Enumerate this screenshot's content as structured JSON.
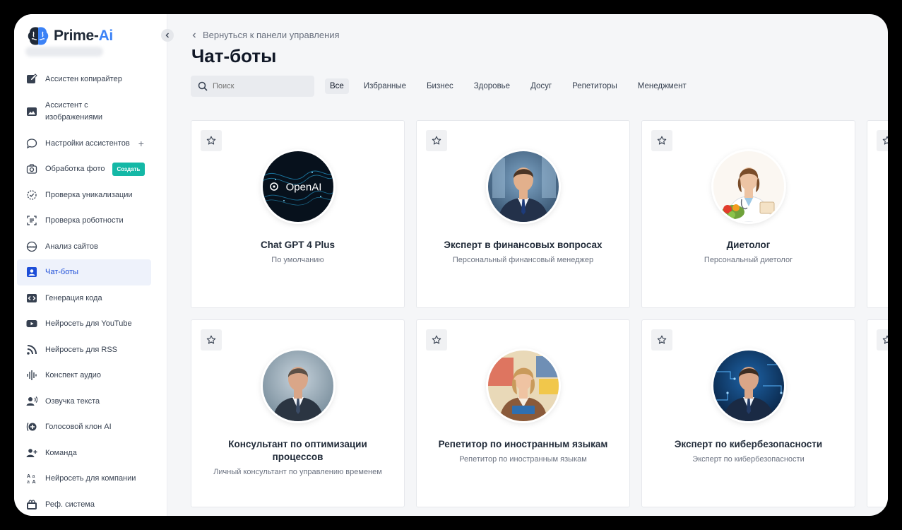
{
  "brand": {
    "name_prefix": "Prime-",
    "name_suffix": "Ai",
    "accent": "#3b82f6"
  },
  "sidebar": {
    "items": [
      {
        "label": "Ассистен копирайтер",
        "icon": "edit-icon"
      },
      {
        "label": "Ассистент с изображениями",
        "icon": "image-icon"
      },
      {
        "label": "Настройки ассистентов",
        "icon": "chat-bubble-icon",
        "extra": "+"
      },
      {
        "label": "Обработка фото",
        "icon": "camera-icon",
        "badge": "Создать"
      },
      {
        "label": "Проверка уникализации",
        "icon": "check-circle-icon"
      },
      {
        "label": "Проверка роботности",
        "icon": "scan-text-icon"
      },
      {
        "label": "Анализ сайтов",
        "icon": "www-globe-icon"
      },
      {
        "label": "Чат-боты",
        "icon": "user-badge-icon",
        "active": true
      },
      {
        "label": "Генерация кода",
        "icon": "code-icon"
      },
      {
        "label": "Нейросеть для YouTube",
        "icon": "youtube-icon"
      },
      {
        "label": "Нейросеть для RSS",
        "icon": "rss-icon"
      },
      {
        "label": "Конспект аудио",
        "icon": "audio-wave-icon"
      },
      {
        "label": "Озвучка текста",
        "icon": "voice-icon"
      },
      {
        "label": "Голосовой клон AI",
        "icon": "voice-clone-icon"
      },
      {
        "label": "Команда",
        "icon": "team-icon"
      },
      {
        "label": "Нейросеть для компании",
        "icon": "translate-icon"
      },
      {
        "label": "Реф. система",
        "icon": "referral-icon"
      }
    ]
  },
  "main": {
    "back_label": "Вернуться к панели управления",
    "title": "Чат-боты",
    "search_placeholder": "Поиск",
    "tabs": [
      "Все",
      "Избранные",
      "Бизнес",
      "Здоровье",
      "Досуг",
      "Репетиторы",
      "Менеджмент"
    ],
    "active_tab": "Все"
  },
  "cards": [
    {
      "title": "Chat GPT 4 Plus",
      "subtitle": "По умолчанию",
      "avatar": "openai",
      "avatar_text": "OpenAI"
    },
    {
      "title": "Эксперт в финансовых вопросах",
      "subtitle": "Персональный финансовый менеджер",
      "avatar": "finance-expert"
    },
    {
      "title": "Диетолог",
      "subtitle": "Персональный диетолог",
      "avatar": "dietitian"
    },
    {
      "title": "Консультант по оптимизации процессов",
      "subtitle": "Личный консультант по управлению временем",
      "avatar": "process-consultant"
    },
    {
      "title": "Репетитор по иностранным языкам",
      "subtitle": "Репетитор по иностранным языкам",
      "avatar": "language-tutor"
    },
    {
      "title": "Эксперт по кибербезопасности",
      "subtitle": "Эксперт по кибербезопасности",
      "avatar": "cyber-expert"
    }
  ]
}
